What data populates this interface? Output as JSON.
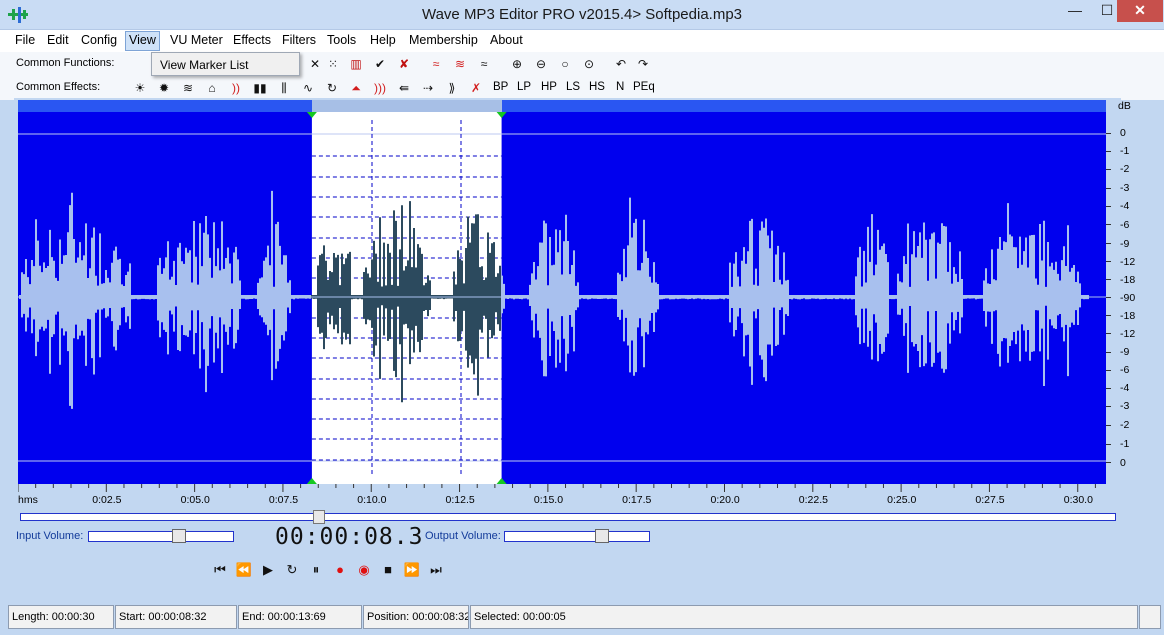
{
  "window": {
    "title": "Wave MP3 Editor PRO v2015.4> Softpedia.mp3",
    "min_glyph": "—",
    "max_glyph": "☐",
    "close_glyph": "✕"
  },
  "menu": {
    "items": [
      "File",
      "Edit",
      "Config",
      "View",
      "VU Meter",
      "Effects",
      "Filters",
      "Tools",
      "Help",
      "Membership",
      "About"
    ],
    "active": "View"
  },
  "dropdown": {
    "items": [
      "View Marker List"
    ]
  },
  "toolbars": {
    "common_functions_label": "Common Functions:",
    "common_effects_label": "Common Effects:",
    "function_icons": [
      "crop-x-icon",
      "select-dots-icon",
      "check-icon",
      "bars-icon",
      "check-cross-icon",
      "wave-red-icon",
      "wave-red-icon",
      "wave-mix-icon",
      "zoom-in-icon",
      "zoom-out-icon",
      "zoom-icon",
      "zoom-fit-icon",
      "undo-icon",
      "redo-icon"
    ],
    "effect_icons": [
      "brightness-icon",
      "darken-icon",
      "wave-icon",
      "dispatch-icon",
      "echo-icon",
      "amplify-icon",
      "compress-icon",
      "wave-level-icon",
      "loop-icon",
      "envelope-icon",
      "fade-icon",
      "reverse-icon",
      "pitch-icon",
      "stretch-icon",
      "noise-icon"
    ],
    "filter_texts": [
      "BP",
      "LP",
      "HP",
      "LS",
      "HS",
      "N",
      "PEq"
    ]
  },
  "db_scale": {
    "title": "dB",
    "labels": [
      "0",
      "-1",
      "-2",
      "-3",
      "-4",
      "-6",
      "-9",
      "-12",
      "-18",
      "-90",
      "-18",
      "-12",
      "-9",
      "-6",
      "-4",
      "-3",
      "-2",
      "-1",
      "0"
    ]
  },
  "time_ruler": {
    "unit": "hms",
    "labels": [
      "0:02.5",
      "0:05.0",
      "0:07.5",
      "0:10.0",
      "0:12.5",
      "0:15.0",
      "0:17.5",
      "0:20.0",
      "0:22.5",
      "0:25.0",
      "0:27.5",
      "0:30.0"
    ]
  },
  "selection": {
    "start_seconds": 8.32,
    "end_seconds": 13.69,
    "total_seconds": 30.8
  },
  "volume": {
    "input_label": "Input Volume:",
    "output_label": "Output Volume:",
    "input_level": 0.62,
    "output_level": 0.67
  },
  "time_display": "00:00:08.3",
  "transport": {
    "buttons": [
      "to-start-icon",
      "rewind-icon",
      "play-icon",
      "loop-icon",
      "pause-icon",
      "record-icon",
      "record-mark-icon",
      "stop-icon",
      "fast-forward-icon",
      "to-end-icon"
    ]
  },
  "status": {
    "length": "Length: 00:00:30",
    "start": "Start: 00:00:08:32",
    "end": "End: 00:00:13:69",
    "position": "Position: 00:00:08:32",
    "selected": "Selected: 00:00:05"
  },
  "colors": {
    "wave_bg": "#0000ee",
    "wave_fg": "#a8c0ee",
    "selection_bg": "#ffffff",
    "selection_wave": "#2c4a5e",
    "grid": "#0000c8",
    "marker": "#14c820"
  }
}
